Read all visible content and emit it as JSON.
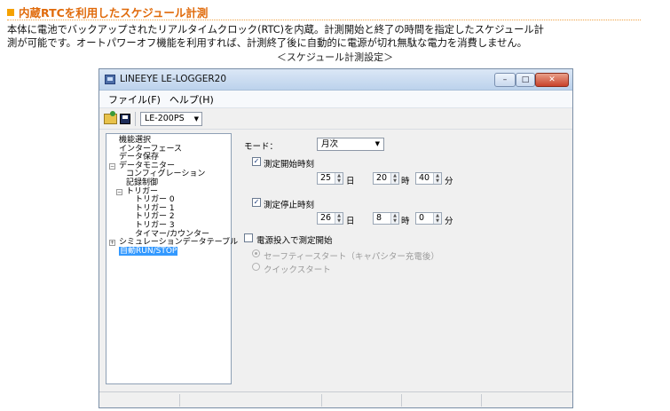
{
  "article": {
    "heading": "内蔵RTCを利用したスケジュール計測",
    "body_line1": "本体に電池でバックアップされたリアルタイムクロック(RTC)を内蔵。計測開始と終了の時間を指定したスケジュール計",
    "body_line2": "測が可能です。オートパワーオフ機能を利用すれば、計測終了後に自動的に電源が切れ無駄な電力を消費しません。",
    "caption": "＜スケジュール計測設定＞"
  },
  "window": {
    "title": "LINEEYE LE-LOGGER20",
    "menu": [
      "ファイル(F)",
      "ヘルプ(H)"
    ],
    "model_select": "LE-200PS"
  },
  "tree": [
    {
      "label": "機能選択",
      "level": 0
    },
    {
      "label": "インターフェース",
      "level": 0
    },
    {
      "label": "データ保存",
      "level": 0
    },
    {
      "label": "データモニター",
      "level": 0,
      "expander": "−"
    },
    {
      "label": "コンフィグレーション",
      "level": 1
    },
    {
      "label": "記録制御",
      "level": 1
    },
    {
      "label": "トリガー",
      "level": 1,
      "expander": "−"
    },
    {
      "label": "トリガー 0",
      "level": 2
    },
    {
      "label": "トリガー 1",
      "level": 2
    },
    {
      "label": "トリガー 2",
      "level": 2
    },
    {
      "label": "トリガー 3",
      "level": 2
    },
    {
      "label": "タイマー/カウンター",
      "level": 2
    },
    {
      "label": "シミュレーションデータテーブル",
      "level": 0,
      "expander": "+"
    },
    {
      "label": "自動RUN/STOP",
      "level": 0,
      "selected": true
    }
  ],
  "panel": {
    "mode_label": "モード：",
    "mode_value": "月次",
    "start_label": "測定開始時刻",
    "start_checked": "✓",
    "start_day": "25",
    "start_hour": "20",
    "start_min": "40",
    "stop_label": "測定停止時刻",
    "stop_checked": "✓",
    "stop_day": "26",
    "stop_hour": "8",
    "stop_min": "0",
    "unit_day": "日",
    "unit_hour": "時",
    "unit_min": "分",
    "poweron_label": "電源投入で測定開始",
    "radio_safe": "セーフティースタート（キャパシター充電後）",
    "radio_quick": "クイックスタート"
  },
  "colors": {
    "heading": "#e06a0a",
    "selected_item": "#3399ff"
  }
}
